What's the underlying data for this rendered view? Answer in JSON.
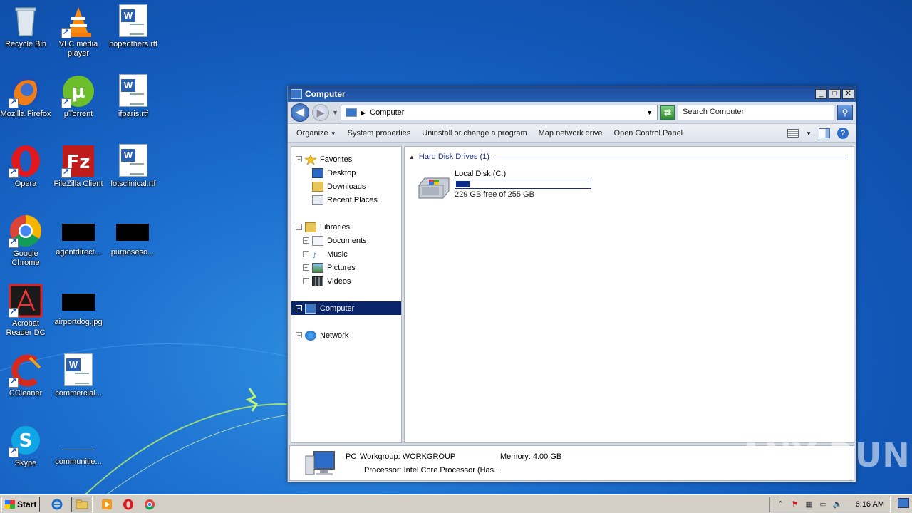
{
  "desktop": {
    "icons": [
      {
        "label": "Recycle Bin"
      },
      {
        "label": "VLC media player"
      },
      {
        "label": "hopeothers.rtf"
      },
      {
        "label": "Mozilla Firefox"
      },
      {
        "label": "µTorrent"
      },
      {
        "label": "ifparis.rtf"
      },
      {
        "label": "Opera"
      },
      {
        "label": "FileZilla Client"
      },
      {
        "label": "lotsclinical.rtf"
      },
      {
        "label": "Google Chrome"
      },
      {
        "label": "agentdirect..."
      },
      {
        "label": "purposeso..."
      },
      {
        "label": "Acrobat Reader DC"
      },
      {
        "label": "airportdog.jpg"
      },
      {
        "label": "CCleaner"
      },
      {
        "label": "commercial..."
      },
      {
        "label": "Skype"
      },
      {
        "label": "communitie..."
      }
    ]
  },
  "window": {
    "title": "Computer",
    "address": "Computer",
    "search_placeholder": "Search Computer",
    "toolbar": {
      "organize": "Organize",
      "system_properties": "System properties",
      "uninstall": "Uninstall or change a program",
      "map_drive": "Map network drive",
      "control_panel": "Open Control Panel"
    },
    "nav": {
      "favorites": "Favorites",
      "desktop": "Desktop",
      "downloads": "Downloads",
      "recent": "Recent Places",
      "libraries": "Libraries",
      "documents": "Documents",
      "music": "Music",
      "pictures": "Pictures",
      "videos": "Videos",
      "computer": "Computer",
      "network": "Network"
    },
    "content": {
      "group_header": "Hard Disk Drives (1)",
      "drive_name": "Local Disk (C:)",
      "drive_free": "229 GB free of 255 GB",
      "drive_used_fraction": 0.102
    },
    "details": {
      "name": "PC",
      "workgroup": "Workgroup: WORKGROUP",
      "memory": "Memory: 4.00 GB",
      "processor": "Processor: Intel Core Processor (Has..."
    }
  },
  "taskbar": {
    "start": "Start",
    "clock": "6:16 AM"
  },
  "watermark": "ANY RUN"
}
